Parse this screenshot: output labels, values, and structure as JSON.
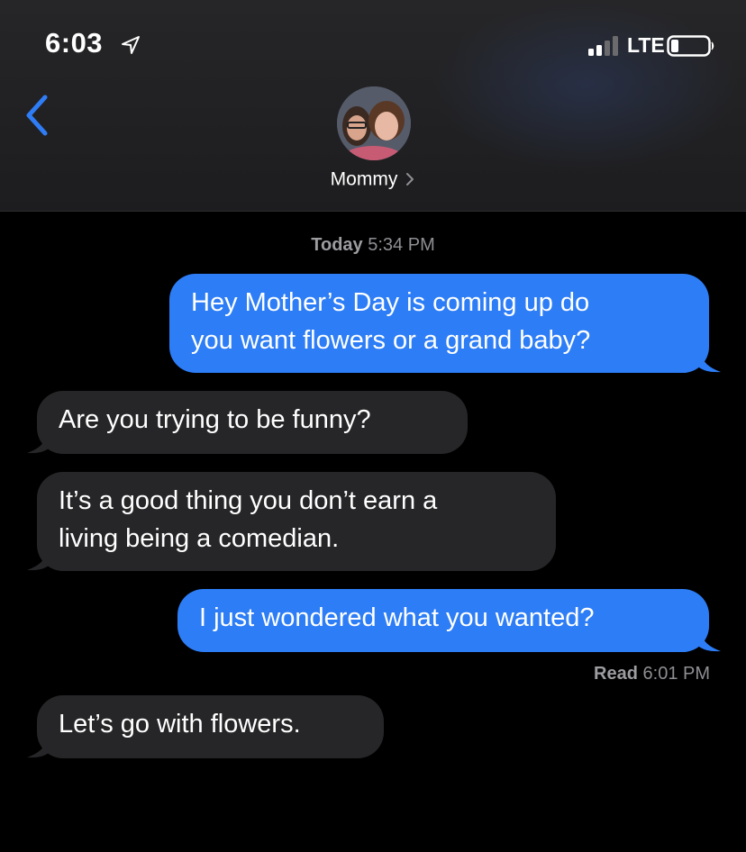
{
  "status_bar": {
    "time": "6:03",
    "network": "LTE",
    "location_icon": "location-arrow-icon",
    "signal_icon": "signal-bars-icon",
    "battery_icon": "battery-icon"
  },
  "header": {
    "back_icon": "chevron-left-icon",
    "contact_name": "Mommy",
    "contact_chevron_icon": "chevron-right-icon",
    "avatar_icon": "contact-photo"
  },
  "thread": {
    "timestamp_day": "Today",
    "timestamp_time": "5:34 PM",
    "messages": [
      {
        "direction": "outgoing",
        "lines": [
          "Hey Mother’s Day is coming up do",
          "you want flowers or a grand baby?"
        ]
      },
      {
        "direction": "incoming",
        "lines": [
          "Are you trying to be funny?"
        ]
      },
      {
        "direction": "incoming",
        "lines": [
          "It’s a good thing you don’t earn a",
          "living being a comedian."
        ]
      },
      {
        "direction": "outgoing",
        "lines": [
          "I just wondered what you wanted?"
        ]
      },
      {
        "direction": "incoming",
        "lines": [
          "Let’s go with flowers."
        ]
      }
    ],
    "read_label": "Read",
    "read_time": "6:01 PM"
  },
  "colors": {
    "outgoing_bubble": "#2d7df6",
    "incoming_bubble": "#262628",
    "accent": "#2f7df6",
    "background": "#000000"
  }
}
